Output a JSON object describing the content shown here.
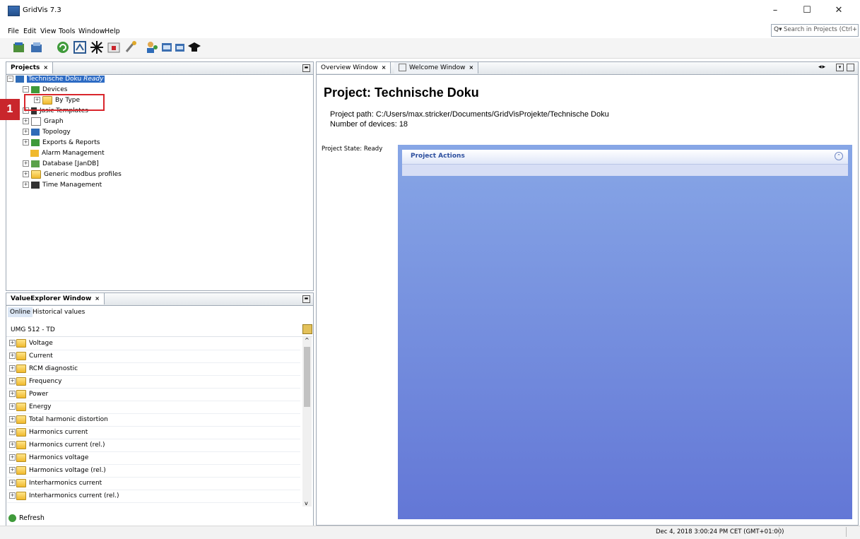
{
  "window": {
    "title": "GridVis 7.3",
    "minimize": "–",
    "maximize": "☐",
    "close": "✕"
  },
  "menu": [
    "File",
    "Edit",
    "View",
    "Tools",
    "Window",
    "Help"
  ],
  "search": {
    "placeholder": "Search in Projects (Ctrl+I)"
  },
  "toolbar": {
    "icons": [
      "new-project-icon",
      "open-project-icon",
      "refresh-icon",
      "device-icon",
      "topology-icon",
      "import-icon",
      "tools-icon",
      "users-icon",
      "window-icon",
      "window2-icon",
      "education-icon"
    ]
  },
  "projects": {
    "tab": "Projects",
    "tree": [
      {
        "label": "Technische Doku",
        "suffix": "Ready",
        "icon": "project-icon"
      },
      {
        "label": "Devices",
        "icon": "devices-icon"
      },
      {
        "label": "By Type",
        "icon": "folder-icon"
      },
      {
        "label": "Jasic Templates",
        "icon": "jasic-icon"
      },
      {
        "label": "Graph",
        "icon": "graph-icon"
      },
      {
        "label": "Topology",
        "icon": "topology-icon"
      },
      {
        "label": "Exports & Reports",
        "icon": "reports-icon"
      },
      {
        "label": "Alarm Management",
        "icon": "alarm-icon"
      },
      {
        "label": "Database [JanDB]",
        "icon": "database-icon"
      },
      {
        "label": "Generic modbus profiles",
        "icon": "folder-icon"
      },
      {
        "label": "Time Management",
        "icon": "time-icon"
      }
    ]
  },
  "value_explorer": {
    "tab": "ValueExplorer Window",
    "subtabs": [
      "Online",
      "Historical values"
    ],
    "device": "UMG 512 - TD",
    "items": [
      "Voltage",
      "Current",
      "RCM diagnostic",
      "Frequency",
      "Power",
      "Energy",
      "Total harmonic distortion",
      "Harmonics current",
      "Harmonics current (rel.)",
      "Harmonics voltage",
      "Harmonics voltage (rel.)",
      "Interharmonics current",
      "Interharmonics current (rel.)"
    ],
    "refresh": "Refresh"
  },
  "editor": {
    "tabs": [
      "Overview Window",
      "Welcome Window"
    ],
    "project_title": "Project: Technische Doku",
    "path": "Project path: C:/Users/max.stricker/Documents/GridVisProjekte/Technische Doku",
    "devices": "Number of devices: 18",
    "state": "Project State: Ready",
    "actions_title": "Project Actions"
  },
  "status": {
    "time": "Dec 4, 2018 3:00:24 PM CET (GMT+01:00)"
  },
  "callout": {
    "number": "1"
  },
  "colors": {
    "selection": "#2d6bc4",
    "callout": "#d9262c",
    "actions_top": "#87a6e6",
    "actions_bottom": "#6377d6"
  }
}
